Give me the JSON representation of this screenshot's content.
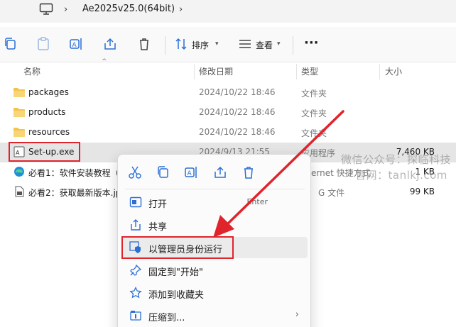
{
  "breadcrumb": {
    "folder": "Ae2025v25.0(64bit)"
  },
  "toolbar": {
    "sort_label": "排序",
    "view_label": "查看",
    "more_label": "···",
    "accent": "#2b6fd6"
  },
  "columns": {
    "name": "名称",
    "date": "修改日期",
    "type": "类型",
    "size": "大小"
  },
  "files": [
    {
      "name": "packages",
      "date": "2024/10/22 18:46",
      "type": "文件夹",
      "size": "",
      "icon": "folder-icon"
    },
    {
      "name": "products",
      "date": "2024/10/22 18:46",
      "type": "文件夹",
      "size": "",
      "icon": "folder-icon"
    },
    {
      "name": "resources",
      "date": "2024/10/22 18:46",
      "type": "文件夹",
      "size": "",
      "icon": "folder-icon"
    },
    {
      "name": "Set-up.exe",
      "date": "2024/9/13 21:55",
      "type": "应用程序",
      "size": "7,460 KB",
      "icon": "setup-exe-icon"
    },
    {
      "name": "必看1：软件安装教程（",
      "date": "",
      "type": "ernet 快捷方式",
      "size": "1 KB",
      "icon": "edge-shortcut-icon"
    },
    {
      "name": "必看2：获取最新版本.jp",
      "date": "",
      "type": "G 文件",
      "size": "99 KB",
      "icon": "image-file-icon"
    }
  ],
  "context_menu": {
    "items": [
      {
        "label": "打开",
        "shortcut": "Enter"
      },
      {
        "label": "共享"
      },
      {
        "label": "以管理员身份运行"
      },
      {
        "label": "固定到\"开始\""
      },
      {
        "label": "添加到收藏夹"
      },
      {
        "label": "压缩到..."
      }
    ]
  },
  "watermark": {
    "line1": "微信公众号：探临科技",
    "line2": "官网：tanlkj.com"
  },
  "colors": {
    "highlight_red": "#e0242c",
    "folder_yellow": "#f4c34c",
    "selected_row": "#e5e5e5"
  }
}
